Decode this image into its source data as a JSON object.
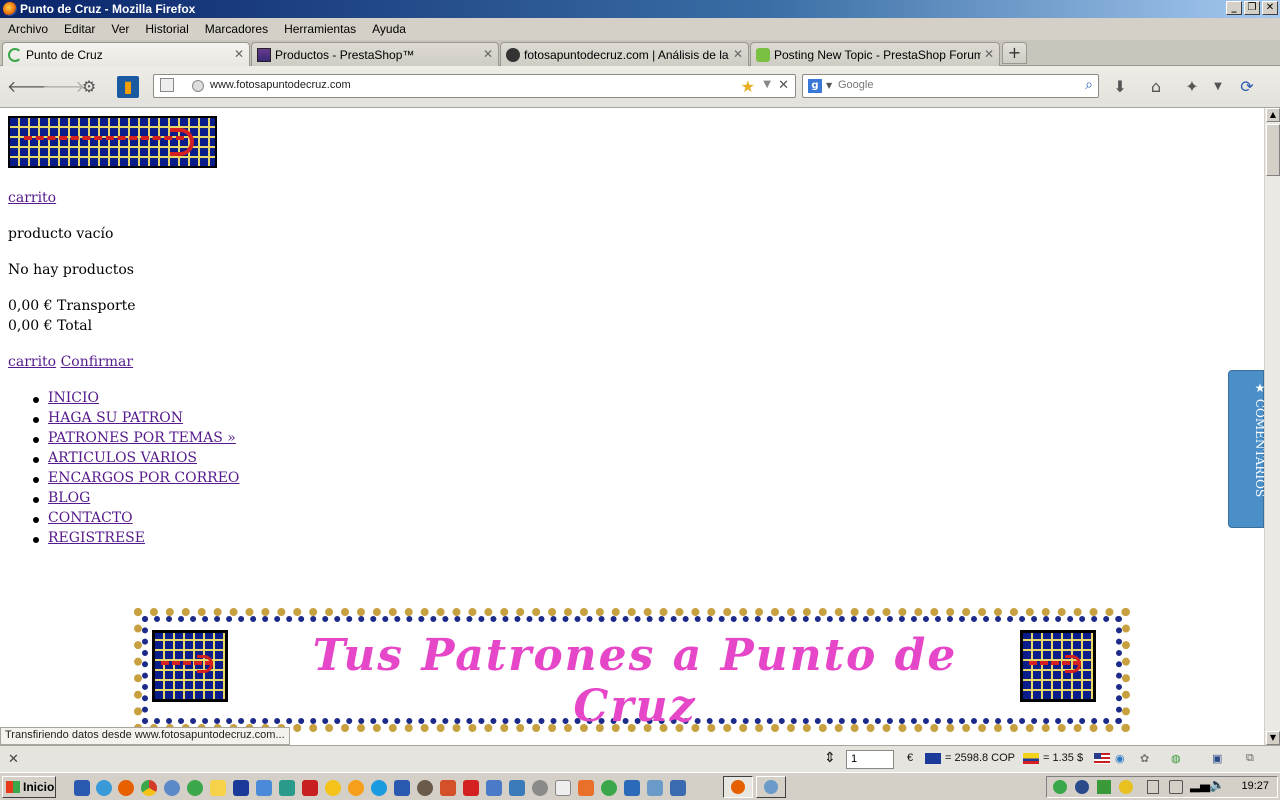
{
  "window": {
    "title": "Punto de Cruz - Mozilla Firefox"
  },
  "menubar": [
    "Archivo",
    "Editar",
    "Ver",
    "Historial",
    "Marcadores",
    "Herramientas",
    "Ayuda"
  ],
  "tabs": [
    {
      "label": "Punto de Cruz",
      "active": true
    },
    {
      "label": "Productos - PrestaShop™",
      "active": false
    },
    {
      "label": "fotosapuntodecruz.com | Análisis de la P...",
      "active": false
    },
    {
      "label": "Posting New Topic - PrestaShop Forums",
      "active": false
    }
  ],
  "navbar": {
    "url": "www.fotosapuntodecruz.com",
    "search_placeholder": "Google"
  },
  "page": {
    "cart_link": "carrito",
    "cart_status": "producto vacío",
    "no_products": "No hay productos",
    "shipping": "0,00 € Transporte",
    "total": "0,00 € Total",
    "cart_link2": "carrito",
    "confirm_link": "Confirmar",
    "menu": [
      "INICIO",
      "HAGA SU PATRON",
      "PATRONES POR TEMAS »",
      "ARTICULOS VARIOS",
      "ENCARGOS POR CORREO",
      "BLOG",
      "CONTACTO",
      "REGISTRESE"
    ],
    "banner_text": "Tus Patrones a Punto de Cruz",
    "comments_tab": "★ COMENTARIOS"
  },
  "status_text": "Transfiriendo datos desde www.fotosapuntodecruz.com...",
  "addonbar": {
    "page_value": "1",
    "euro_symbol": "€",
    "cop_rate": "= 2598.8 COP",
    "usd_rate": "= 1.35 $"
  },
  "taskbar": {
    "start_label": "Inicio",
    "clock": "19:27"
  },
  "colors": {
    "link": "#551a8b",
    "banner_pink": "#e646c8",
    "comments_tab": "#4a8fc8"
  }
}
